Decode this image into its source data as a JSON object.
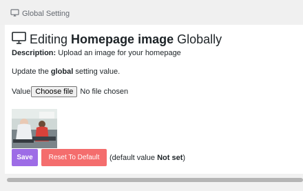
{
  "topbar": {
    "title": "Global Setting",
    "icon": "monitor-icon"
  },
  "heading": {
    "prefix": "Editing ",
    "emphasis": "Homepage image",
    "suffix": " Globally",
    "icon": "monitor-icon"
  },
  "description": {
    "label": "Description:",
    "text": " Upload an image for your homepage"
  },
  "update": {
    "prefix": "Update the ",
    "emphasis": "global",
    "suffix": " setting value."
  },
  "value_field": {
    "label": "Value",
    "button_label": "Choose file",
    "status": "No file chosen"
  },
  "actions": {
    "save_label": "Save",
    "reset_label": "Reset To Default",
    "note_prefix": "(default value ",
    "note_emphasis": "Not set",
    "note_suffix": ")"
  },
  "colors": {
    "save_button": "#9d6ce6",
    "reset_button": "#f46d6d"
  }
}
